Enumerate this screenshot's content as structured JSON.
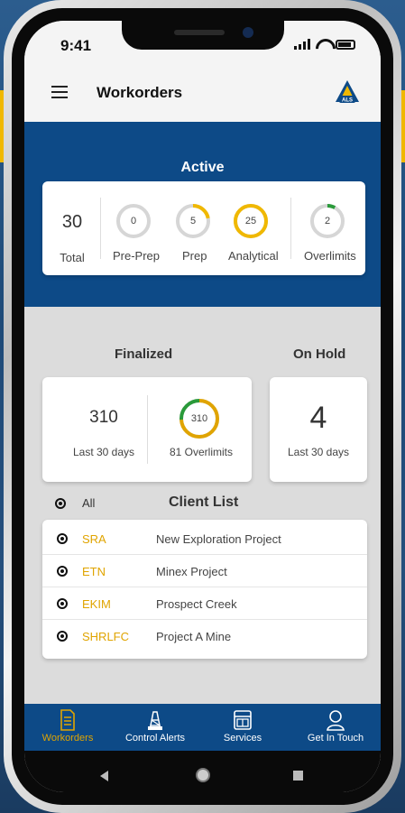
{
  "status": {
    "time": "9:41"
  },
  "header": {
    "title": "Workorders",
    "logo_text": "ALS"
  },
  "active": {
    "title": "Active",
    "total_value": "30",
    "total_label": "Total",
    "rings": [
      {
        "label": "Pre-Prep",
        "value": "0",
        "fill": 0.0,
        "color": "#f0b800"
      },
      {
        "label": "Prep",
        "value": "5",
        "fill": 0.22,
        "color": "#f0b800"
      },
      {
        "label": "Analytical",
        "value": "25",
        "fill": 1.0,
        "color": "#f0b800"
      },
      {
        "label": "Overlimits",
        "value": "2",
        "fill": 0.08,
        "color": "#2a9a3a"
      }
    ]
  },
  "finalized": {
    "title": "Finalized",
    "value": "310",
    "label": "Last 30 days",
    "ring_value": "310",
    "ring_label": "81 Overlimits",
    "ring_fill_main": 0.74,
    "ring_fill_over": 0.26
  },
  "on_hold": {
    "title": "On Hold",
    "value": "4",
    "label": "Last 30 days"
  },
  "client_list": {
    "filter_label": "All",
    "title": "Client List",
    "clients": [
      {
        "code": "SRA",
        "name": "New Exploration Project"
      },
      {
        "code": "ETN",
        "name": "Minex Project"
      },
      {
        "code": "EKIM",
        "name": "Prospect Creek"
      },
      {
        "code": "SHRLFC",
        "name": "Project A Mine"
      }
    ]
  },
  "nav": [
    {
      "label": "Workorders",
      "icon": "document-icon"
    },
    {
      "label": "Control Alerts",
      "icon": "tower-icon"
    },
    {
      "label": "Services",
      "icon": "services-icon"
    },
    {
      "label": "Get In Touch",
      "icon": "person-icon"
    }
  ],
  "colors": {
    "brand_blue": "#0d4a87",
    "accent_yellow": "#e0a400",
    "overlimit_green": "#2a9a3a"
  }
}
